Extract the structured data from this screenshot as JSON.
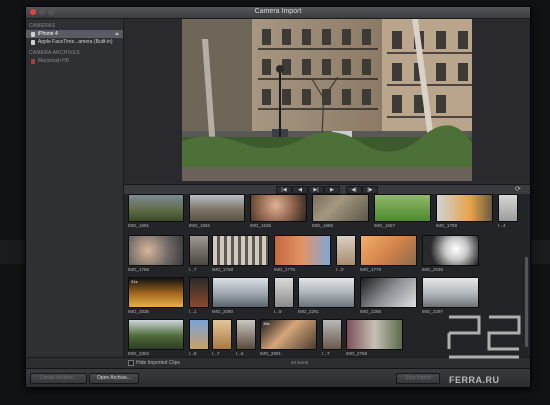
{
  "window": {
    "title": "Camera Import"
  },
  "sidebar": {
    "cameras_header": "CAMERAS",
    "cameras": [
      {
        "label": "iPhone 4",
        "selected": true
      },
      {
        "label": "Apple FaceTime...amera (Built-in)",
        "selected": false
      }
    ],
    "archives_header": "CAMERA ARCHIVES",
    "archives": [
      {
        "label": "Macintosh HD"
      }
    ]
  },
  "transport": {
    "buttons": [
      "|◀",
      "◀",
      "▶|",
      "▶",
      "◀|",
      "|▶"
    ]
  },
  "clips": {
    "row1": [
      "IMG_1591",
      "IMG_1592",
      "IMG_1636",
      "IMG_1656",
      "IMG_1657",
      "IMG_1759",
      "I...4"
    ],
    "row2": [
      "IMG_1756",
      "I...7",
      "IMG_1768",
      "IMG_1776",
      "I...0",
      "IMG_1779",
      "IMG_2035"
    ],
    "row3": [
      "IMG_2036",
      "I...1",
      "IMG_2080",
      "I...9",
      "IMG_2291",
      "IMG_2296",
      "IMG_2297"
    ],
    "row4": [
      "IMG_2304",
      "I...8",
      "I...7",
      "I...6",
      "IMG_2691",
      "I...7",
      "IMG_2758"
    ],
    "durations": [
      "31s",
      "35s"
    ]
  },
  "bottom": {
    "hide_imported": "Hide Imported Clips",
    "item_count": "40 items"
  },
  "footer": {
    "create_archive": "Create Archive...",
    "open_archive": "Open Archive...",
    "stop_import": "Stop Import"
  },
  "watermark": {
    "text": "FERRA.RU"
  }
}
